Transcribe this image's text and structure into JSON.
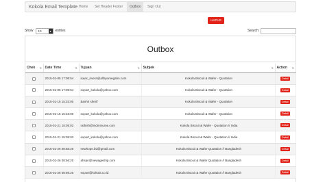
{
  "navbar": {
    "brand": "Kokola Email Template",
    "items": [
      {
        "label": "Home",
        "active": false
      },
      {
        "label": "Set Header Footer",
        "active": false
      },
      {
        "label": "Outbox",
        "active": true
      },
      {
        "label": "Sign Out",
        "active": false
      }
    ]
  },
  "hapus_label": "HAPUS",
  "length": {
    "prefix": "Show",
    "value": "10",
    "suffix": "entries"
  },
  "search": {
    "label": "Search:",
    "value": ""
  },
  "title": "Outbox",
  "table": {
    "columns": [
      "Chek",
      "Date Time",
      "Tujuan",
      "Subjek",
      "Action"
    ],
    "action_label": "Detail",
    "rows": [
      {
        "datetime": "2015-01-05 17:08:54",
        "tujuan": "isaac_rivera@alfayomegahn.com",
        "subjek": "Kokola Biscuit & Wafer - Quotation"
      },
      {
        "datetime": "2015-01-05 17:08:54",
        "tujuan": "export_kokola@yahoo.com",
        "subjek": "Kokola Biscuit & Wafer - Quotation"
      },
      {
        "datetime": "2015-01-15 15:33:00",
        "tujuan": "Bashir sherif",
        "subjek": "Kokola Biscuit & Wafer - Quotation"
      },
      {
        "datetime": "2015-01-15 15:33:00",
        "tujuan": "export_kokola@yahoo.com",
        "subjek": "Kokola Biscuit & Wafer - Quotation"
      },
      {
        "datetime": "2015-01-21 15:05:03",
        "tujuan": "rathish@mdmmume.com",
        "subjek": "Kokola Biscuit & Wafer - Quotation // India"
      },
      {
        "datetime": "2015-01-21 15:05:03",
        "tujuan": "export_kokola@yahoo.com",
        "subjek": "Kokola Biscuit & Wafer - Quotation // India"
      },
      {
        "datetime": "2015-01-26 08:56:20",
        "tujuan": "newhope.bd@gmail.com",
        "subjek": "Kokola Biscuit & Wafer Quotation // Bangladesh"
      },
      {
        "datetime": "2015-01-26 08:56:20",
        "tujuan": "ahsan@newageship.com",
        "subjek": "Kokola Biscuit & Wafer Quotation // Bangladesh"
      },
      {
        "datetime": "2015-01-26 08:56:20",
        "tujuan": "export@kokola.co.id",
        "subjek": "Kokola Biscuit & Wafer Quotation // Bangladesh"
      }
    ]
  },
  "colors": {
    "accent_red": "#e2231a",
    "row_stripe": "#f4f4f4"
  }
}
